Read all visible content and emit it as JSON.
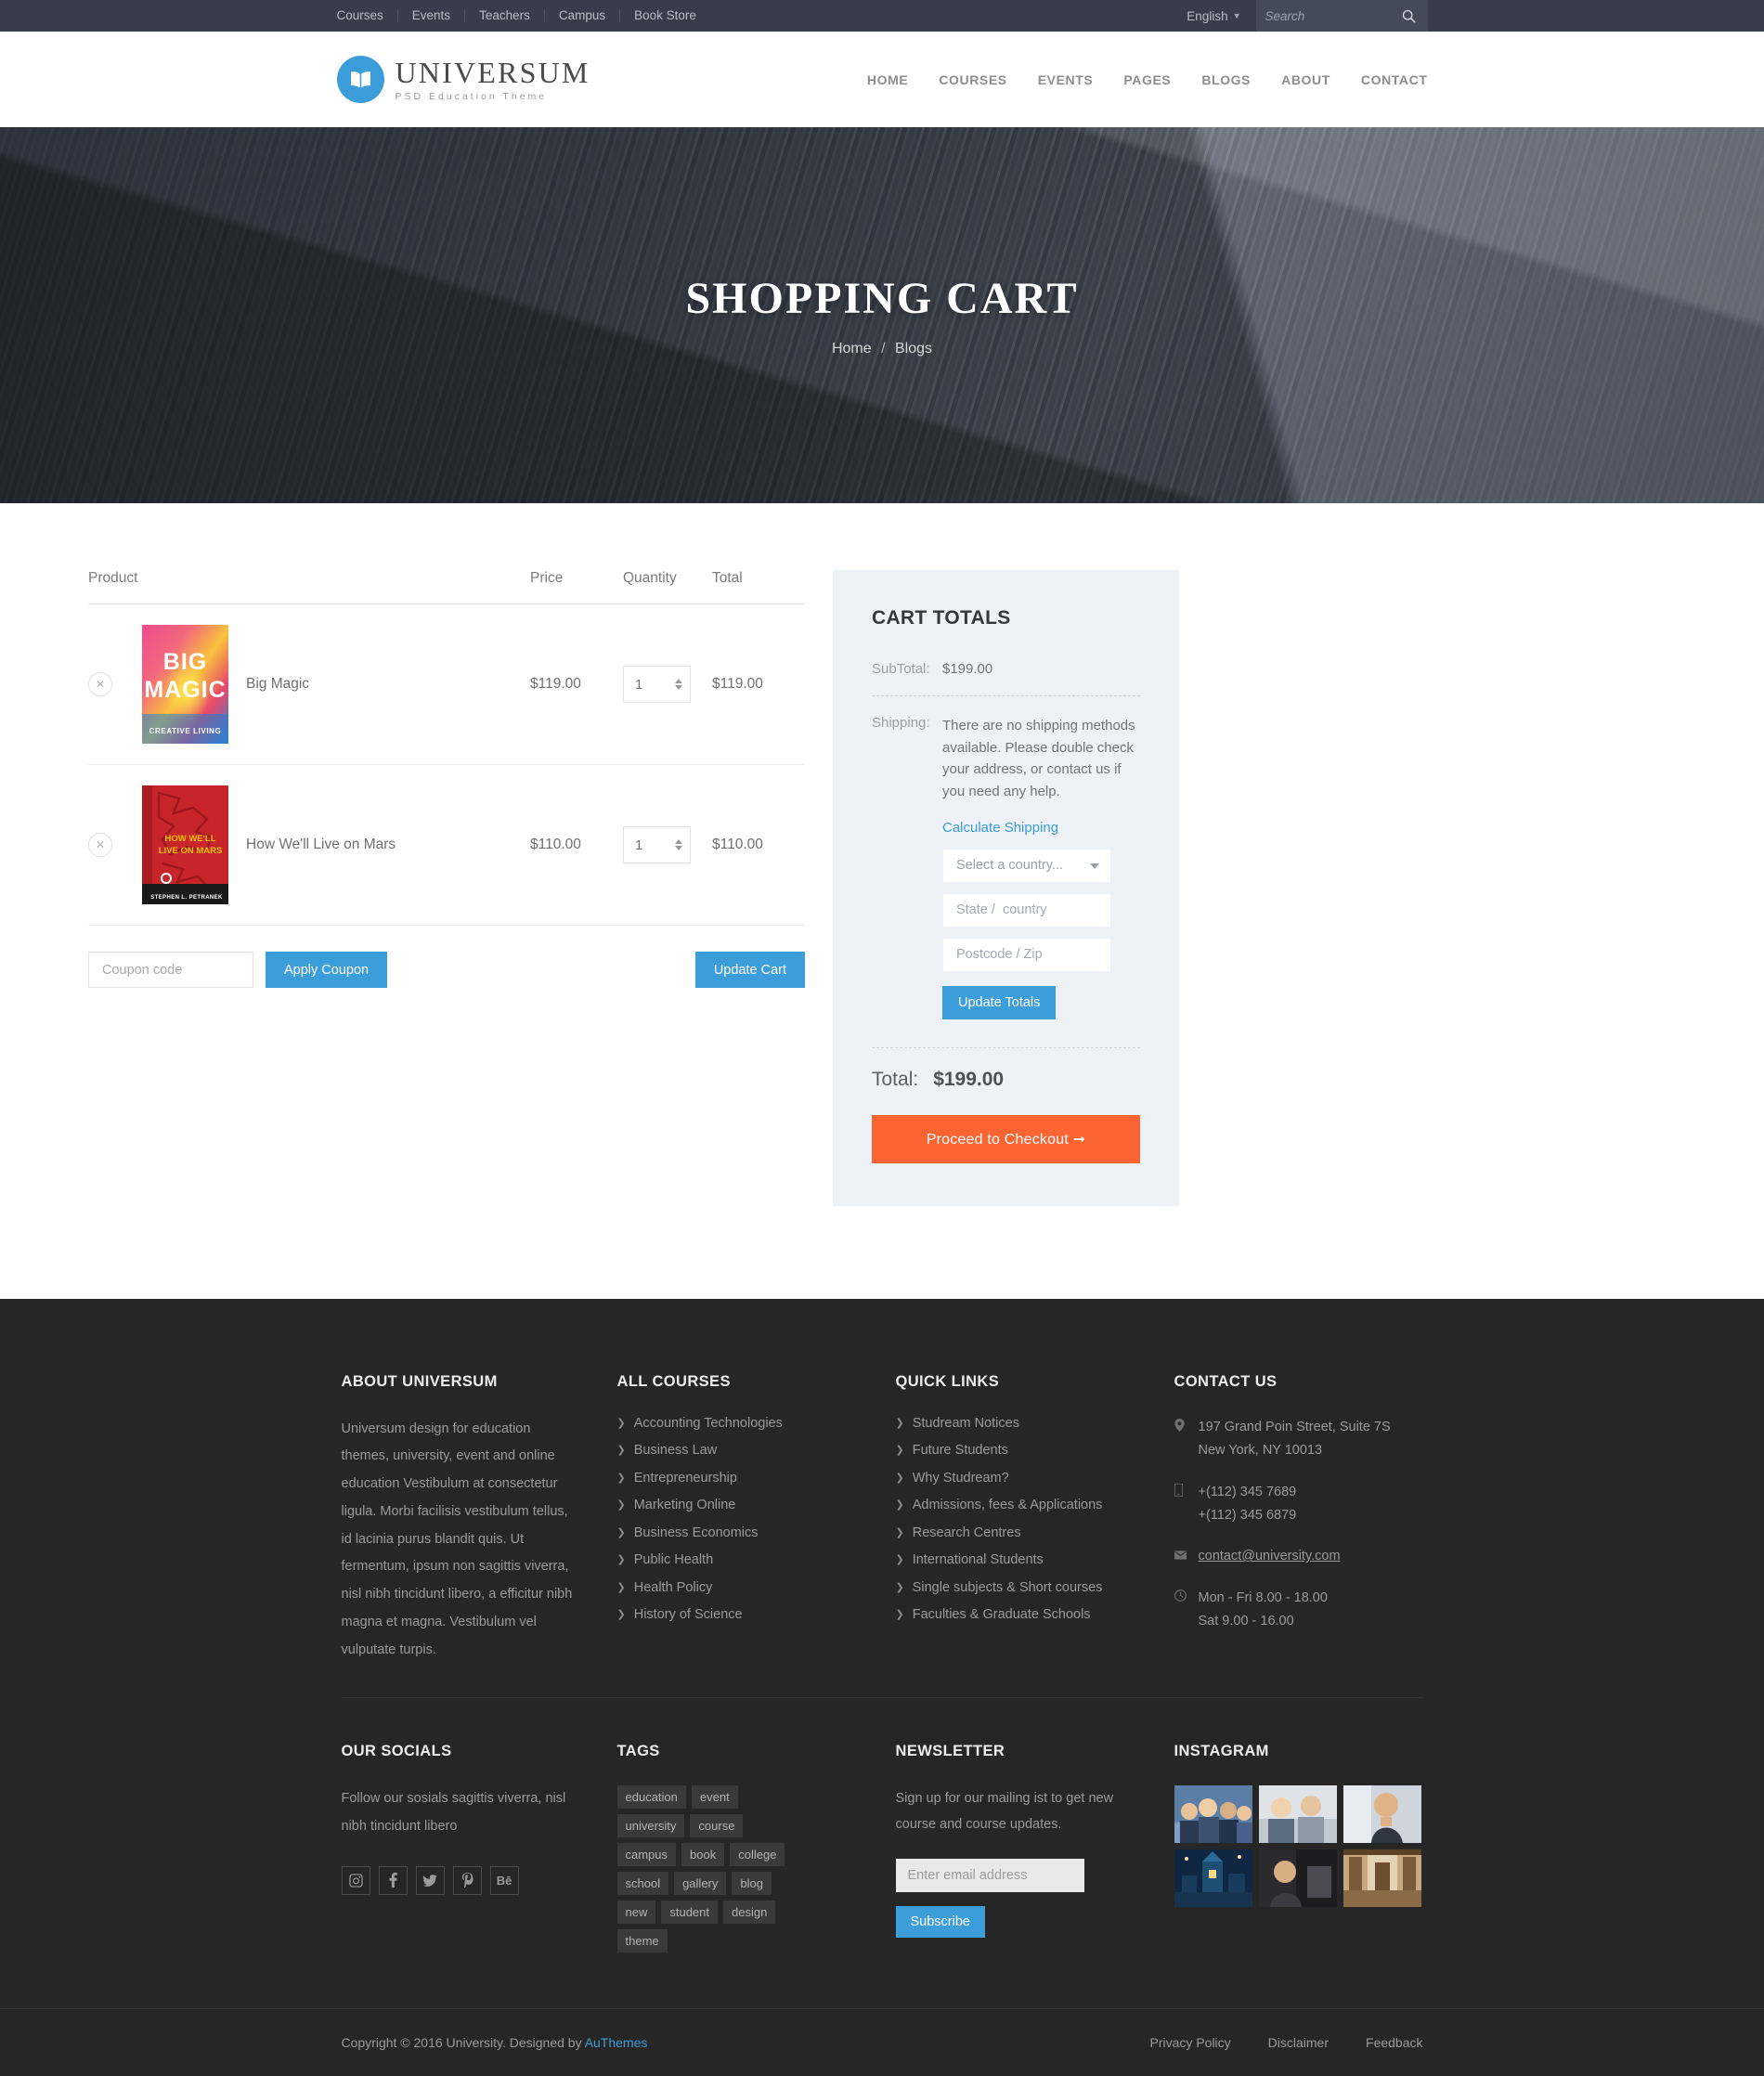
{
  "topbar": {
    "links": [
      "Courses",
      "Events",
      "Teachers",
      "Campus",
      "Book Store"
    ],
    "language": "English",
    "search_placeholder": "Search"
  },
  "header": {
    "brand": "UNIVERSUM",
    "tagline": "PSD Education Theme",
    "nav": [
      "HOME",
      "COURSES",
      "EVENTS",
      "PAGES",
      "BLOGS",
      "ABOUT",
      "CONTACT"
    ]
  },
  "hero": {
    "title": "SHOPPING CART",
    "breadcrumb_home": "Home",
    "breadcrumb_sep": "/",
    "breadcrumb_current": "Blogs"
  },
  "cart": {
    "columns": {
      "product": "Product",
      "price": "Price",
      "quantity": "Quantity",
      "total": "Total"
    },
    "items": [
      {
        "name": "Big Magic",
        "price": "$119.00",
        "qty": "1",
        "total": "$119.00",
        "cover_title": "BIG MAGIC",
        "cover_sub": "CREATIVE LIVING"
      },
      {
        "name": "How We'll Live on Mars",
        "price": "$110.00",
        "qty": "1",
        "total": "$110.00",
        "cover_title": "HOW WE'LL LIVE ON MARS",
        "cover_sub": "STEPHEN L. PETRANEK"
      }
    ],
    "coupon_placeholder": "Coupon code",
    "apply_coupon_label": "Apply Coupon",
    "update_cart_label": "Update Cart"
  },
  "totals": {
    "heading": "CART TOTALS",
    "subtotal_label": "SubTotal:",
    "subtotal_value": "$199.00",
    "shipping_label": "Shipping:",
    "shipping_text": "There are no shipping methods available. Please double check your address, or contact us if you need any help.",
    "calculate_link": "Calculate Shipping",
    "country_placeholder": "Select a country...",
    "state_placeholder": "State /  country",
    "postcode_placeholder": "Postcode / Zip",
    "update_totals_label": "Update Totals",
    "total_label": "Total:",
    "total_value": "$199.00",
    "checkout_label": "Proceed to Checkout",
    "checkout_arrow": "➞"
  },
  "footer": {
    "about": {
      "heading": "ABOUT UNIVERSUM",
      "text": "Universum design for education themes,  university, event and online education Vestibulum at consectetur ligula. Morbi facilisis vestibulum tellus, id lacinia purus blandit quis. Ut fermentum, ipsum non sagittis viverra, nisl nibh tincidunt libero, a efficitur nibh magna et magna. Vestibulum vel vulputate turpis."
    },
    "courses": {
      "heading": "ALL COURSES",
      "items": [
        "Accounting Technologies",
        "Business Law",
        "Entrepreneurship",
        "Marketing Online",
        "Business Economics",
        "Public Health",
        "Health Policy",
        "History of Science"
      ]
    },
    "quick": {
      "heading": "QUICK LINKS",
      "items": [
        "Studream Notices",
        "Future Students",
        "Why Studream?",
        "Admissions, fees & Applications",
        "Research Centres",
        "International Students",
        "Single subjects & Short courses",
        "Faculties & Graduate Schools"
      ]
    },
    "contact": {
      "heading": "CONTACT US",
      "address": "197 Grand Poin Street, Suite 7S New York, NY 10013",
      "phone1": "+(112) 345 7689",
      "phone2": "+(112) 345 6879",
      "email": "contact@university.com",
      "hours1": "Mon - Fri 8.00 - 18.00",
      "hours2": "Sat 9.00 - 16.00"
    },
    "socials": {
      "heading": "OUR SOCIALS",
      "text": "Follow our sosials sagittis viverra, nisl nibh tincidunt libero",
      "icons": [
        "instagram-icon",
        "facebook-icon",
        "twitter-icon",
        "pinterest-icon",
        "behance-icon"
      ]
    },
    "tags": {
      "heading": "TAGS",
      "items": [
        "education",
        "event",
        "university",
        "course",
        "campus",
        "book",
        "college",
        "school",
        "gallery",
        "blog",
        "new",
        "student",
        "design",
        "theme"
      ]
    },
    "newsletter": {
      "heading": "NEWSLETTER",
      "text": "Sign up for our mailing ist to get new course and course updates.",
      "placeholder": "Enter email address",
      "button": "Subscribe"
    },
    "instagram": {
      "heading": "INSTAGRAM",
      "count": 6
    },
    "bottom": {
      "copyright_prefix": "Copyright © 2016 University. Designed by ",
      "copyright_link": "AuThemes",
      "links": [
        "Privacy Policy",
        "Disclaimer",
        "Feedback"
      ]
    }
  },
  "colors": {
    "accent_blue": "#3c9ddb",
    "accent_orange": "#fa6432",
    "topbar_bg": "#373d4a",
    "footer_bg": "#262626",
    "totals_bg": "#eef1f6"
  }
}
